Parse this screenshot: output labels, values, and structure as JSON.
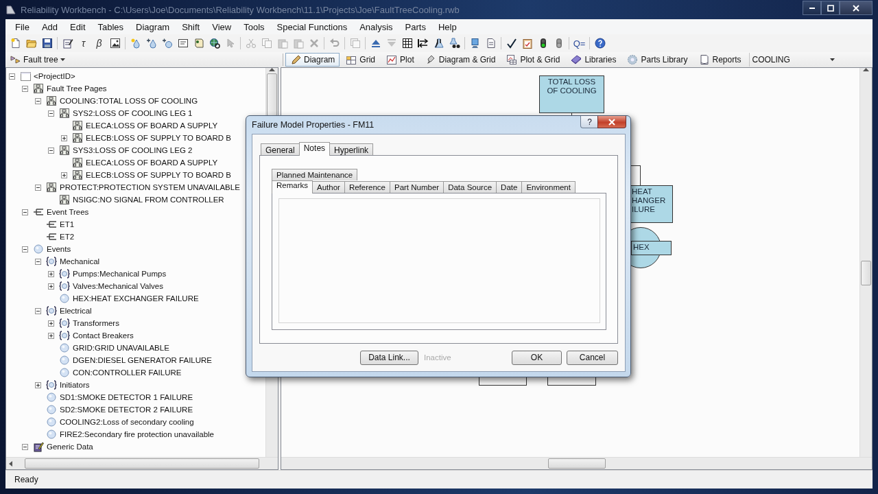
{
  "window": {
    "title": "Reliability Workbench - C:\\Users\\Joe\\Documents\\Reliability Workbench\\11.1\\Projects\\Joe\\FaultTreeCooling.rwb"
  },
  "menu": [
    "File",
    "Add",
    "Edit",
    "Tables",
    "Diagram",
    "Shift",
    "View",
    "Tools",
    "Special Functions",
    "Analysis",
    "Parts",
    "Help"
  ],
  "toolbar": [
    {
      "kind": "icon",
      "disabled": false
    },
    {
      "kind": "icon",
      "disabled": false
    },
    {
      "kind": "icon",
      "disabled": false
    },
    {
      "kind": "separator"
    },
    {
      "kind": "icon",
      "disabled": false
    },
    {
      "kind": "glyph",
      "text": "τ",
      "disabled": false
    },
    {
      "kind": "glyph",
      "text": "β",
      "disabled": false
    },
    {
      "kind": "icon",
      "disabled": false
    },
    {
      "kind": "separator"
    },
    {
      "kind": "icon",
      "disabled": false
    },
    {
      "kind": "icon",
      "disabled": false
    },
    {
      "kind": "icon",
      "disabled": false
    },
    {
      "kind": "icon",
      "disabled": false
    },
    {
      "kind": "icon",
      "disabled": false
    },
    {
      "kind": "icon",
      "disabled": false
    },
    {
      "kind": "icon",
      "disabled": true
    },
    {
      "kind": "separator"
    },
    {
      "kind": "icon",
      "disabled": true
    },
    {
      "kind": "icon",
      "disabled": true
    },
    {
      "kind": "icon",
      "disabled": true
    },
    {
      "kind": "icon",
      "disabled": true
    },
    {
      "kind": "icon",
      "disabled": true
    },
    {
      "kind": "separator"
    },
    {
      "kind": "icon",
      "disabled": true
    },
    {
      "kind": "separator"
    },
    {
      "kind": "icon",
      "disabled": true
    },
    {
      "kind": "separator"
    },
    {
      "kind": "icon",
      "disabled": false
    },
    {
      "kind": "icon",
      "disabled": true
    },
    {
      "kind": "icon",
      "disabled": false
    },
    {
      "kind": "icon",
      "disabled": false
    },
    {
      "kind": "icon",
      "disabled": false
    },
    {
      "kind": "icon",
      "disabled": false
    },
    {
      "kind": "separator"
    },
    {
      "kind": "icon",
      "disabled": false
    },
    {
      "kind": "icon",
      "disabled": false
    },
    {
      "kind": "separator"
    },
    {
      "kind": "icon",
      "disabled": false
    },
    {
      "kind": "icon",
      "disabled": false
    },
    {
      "kind": "icon",
      "disabled": false
    },
    {
      "kind": "icon",
      "disabled": false
    },
    {
      "kind": "separator"
    },
    {
      "kind": "glyph",
      "text": "Q=",
      "disabled": false
    },
    {
      "kind": "separator"
    },
    {
      "kind": "icon",
      "disabled": false
    }
  ],
  "mode_selector": {
    "label": "Fault tree"
  },
  "views": [
    {
      "label": "Diagram",
      "selected": true
    },
    {
      "label": "Grid",
      "selected": false
    },
    {
      "label": "Plot",
      "selected": false
    },
    {
      "label": "Diagram & Grid",
      "selected": false
    },
    {
      "label": "Plot & Grid",
      "selected": false
    },
    {
      "label": "Libraries",
      "selected": false
    },
    {
      "label": "Parts Library",
      "selected": false
    },
    {
      "label": "Reports",
      "selected": false
    }
  ],
  "page_selector": {
    "value": "COOLING"
  },
  "tree": [
    {
      "label": "<ProjectID>",
      "kind": "project",
      "expanded": true,
      "children": [
        {
          "label": "Fault Tree Pages",
          "kind": "page",
          "expanded": true,
          "children": [
            {
              "label": "COOLING:TOTAL LOSS OF COOLING",
              "kind": "page",
              "expanded": true,
              "children": [
                {
                  "label": "SYS2:LOSS OF COOLING LEG 1",
                  "kind": "page",
                  "expanded": true,
                  "children": [
                    {
                      "label": "ELECA:LOSS OF BOARD A SUPPLY",
                      "kind": "page"
                    },
                    {
                      "label": "ELECB:LOSS OF SUPPLY TO BOARD B",
                      "kind": "page",
                      "expanded": false
                    }
                  ]
                },
                {
                  "label": "SYS3:LOSS OF COOLING LEG 2",
                  "kind": "page",
                  "expanded": true,
                  "children": [
                    {
                      "label": "ELECA:LOSS OF BOARD A SUPPLY",
                      "kind": "page"
                    },
                    {
                      "label": "ELECB:LOSS OF SUPPLY TO BOARD B",
                      "kind": "page",
                      "expanded": false
                    }
                  ]
                }
              ]
            },
            {
              "label": "PROTECT:PROTECTION SYSTEM UNAVAILABLE",
              "kind": "page",
              "expanded": true,
              "children": [
                {
                  "label": "NSIGC:NO SIGNAL FROM CONTROLLER",
                  "kind": "page"
                }
              ]
            }
          ]
        },
        {
          "label": "Event Trees",
          "kind": "eventtree",
          "expanded": true,
          "children": [
            {
              "label": "ET1",
              "kind": "eventtree"
            },
            {
              "label": "ET2",
              "kind": "eventtree"
            }
          ]
        },
        {
          "label": "Events",
          "kind": "event",
          "expanded": true,
          "children": [
            {
              "label": "Mechanical",
              "kind": "group",
              "expanded": true,
              "children": [
                {
                  "label": "Pumps:Mechanical Pumps",
                  "kind": "group",
                  "expanded": false
                },
                {
                  "label": "Valves:Mechanical Valves",
                  "kind": "group",
                  "expanded": false
                },
                {
                  "label": "HEX:HEAT EXCHANGER FAILURE",
                  "kind": "event"
                }
              ]
            },
            {
              "label": "Electrical",
              "kind": "group",
              "expanded": true,
              "children": [
                {
                  "label": "Transformers",
                  "kind": "group",
                  "expanded": false
                },
                {
                  "label": "Contact Breakers",
                  "kind": "group",
                  "expanded": false
                },
                {
                  "label": "GRID:GRID UNAVAILABLE",
                  "kind": "event"
                },
                {
                  "label": "DGEN:DIESEL GENERATOR FAILURE",
                  "kind": "event"
                },
                {
                  "label": "CON:CONTROLLER FAILURE",
                  "kind": "event"
                }
              ]
            },
            {
              "label": "Initiators",
              "kind": "group",
              "expanded": false
            },
            {
              "label": "SD1:SMOKE DETECTOR 1 FAILURE",
              "kind": "event"
            },
            {
              "label": "SD2:SMOKE DETECTOR 2 FAILURE",
              "kind": "event"
            },
            {
              "label": "COOLING2:Loss of secondary cooling",
              "kind": "event"
            },
            {
              "label": "FIRE2:Secondary fire protection unavailable",
              "kind": "event"
            }
          ]
        },
        {
          "label": "Generic Data",
          "kind": "generic",
          "expanded": true
        }
      ]
    }
  ],
  "diagram": {
    "nodes": [
      {
        "kind": "event_box",
        "lines": [
          "TOTAL LOSS",
          "OF COOLING"
        ]
      },
      {
        "kind": "gate_box"
      },
      {
        "kind": "event_box",
        "lines": [
          "HEAT",
          "HANGER",
          "ILURE"
        ]
      },
      {
        "kind": "basic_event",
        "label": "HEX"
      },
      {
        "kind": "gate_box"
      },
      {
        "kind": "gate_box"
      }
    ]
  },
  "dialog": {
    "title": "Failure Model Properties - FM11",
    "help_button": "?",
    "tabs": [
      {
        "label": "General",
        "selected": false
      },
      {
        "label": "Notes",
        "selected": true
      },
      {
        "label": "Hyperlink",
        "selected": false
      }
    ],
    "note_tab_rows": [
      {
        "tabs": [
          {
            "label": "Planned Maintenance",
            "selected": false
          }
        ]
      },
      {
        "tabs": [
          {
            "label": "Remarks",
            "selected": true
          },
          {
            "label": "Author",
            "selected": false
          },
          {
            "label": "Reference",
            "selected": false
          },
          {
            "label": "Part Number",
            "selected": false
          },
          {
            "label": "Data Source",
            "selected": false
          },
          {
            "label": "Date",
            "selected": false
          },
          {
            "label": "Environment",
            "selected": false
          }
        ]
      }
    ],
    "data_link_button": "Data Link...",
    "link_status": {
      "text": "Inactive",
      "disabled": true
    },
    "buttons": [
      "OK",
      "Cancel"
    ]
  },
  "status_bar": {
    "text": "Ready"
  }
}
